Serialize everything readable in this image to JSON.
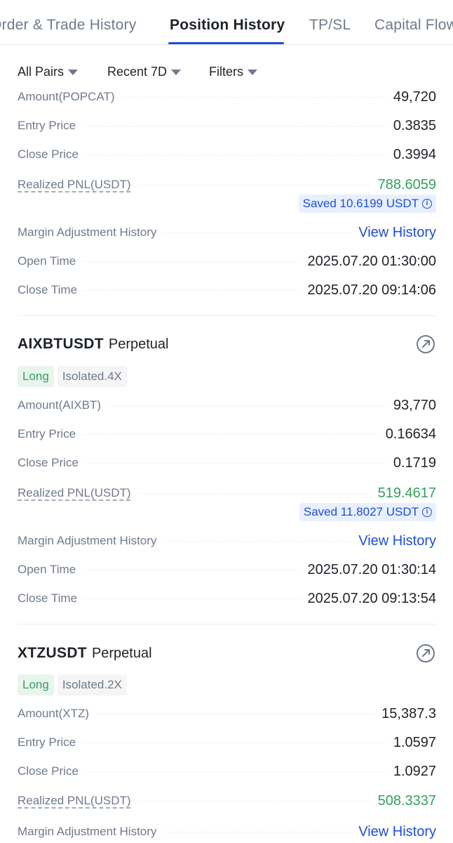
{
  "tabs": [
    {
      "label": "Order & Trade History",
      "active": false
    },
    {
      "label": "Position History",
      "active": true
    },
    {
      "label": "TP/SL",
      "active": false
    },
    {
      "label": "Capital Flow",
      "active": false
    }
  ],
  "filters": {
    "pairs": "All Pairs",
    "range": "Recent 7D",
    "filters": "Filters"
  },
  "colors": {
    "accent": "#1f4fd6",
    "positive": "#33a05f",
    "muted": "#707a8a"
  },
  "labels": {
    "realized_pnl": "Realized PNL(USDT)",
    "margin_history": "Margin Adjustment History",
    "view_history": "View History",
    "open_time": "Open Time",
    "close_time": "Close Time",
    "entry_price": "Entry Price",
    "close_price": "Close Price",
    "perpetual": "Perpetual",
    "long": "Long"
  },
  "positions": [
    {
      "amount_label": "Amount(POPCAT)",
      "amount": "49,720",
      "entry_price": "0.3835",
      "close_price": "0.3994",
      "pnl": "788.6059",
      "saved": "Saved 10.6199 USDT",
      "open_time": "2025.07.20 01:30:00",
      "close_time": "2025.07.20 09:14:06"
    },
    {
      "symbol": "AIXBTUSDT",
      "side": "Long",
      "margin": "Isolated.4X",
      "amount_label": "Amount(AIXBT)",
      "amount": "93,770",
      "entry_price": "0.16634",
      "close_price": "0.1719",
      "pnl": "519.4617",
      "saved": "Saved 11.8027 USDT",
      "open_time": "2025.07.20 01:30:14",
      "close_time": "2025.07.20 09:13:54"
    },
    {
      "symbol": "XTZUSDT",
      "side": "Long",
      "margin": "Isolated.2X",
      "amount_label": "Amount(XTZ)",
      "amount": "15,387.3",
      "entry_price": "1.0597",
      "close_price": "1.0927",
      "pnl": "508.3337"
    }
  ]
}
